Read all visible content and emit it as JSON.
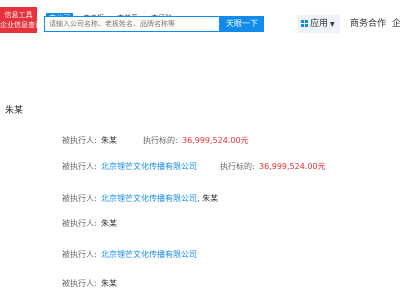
{
  "logo": {
    "line1": "信息工具",
    "line2": "企业信息查询"
  },
  "search": {
    "tabs": [
      "查公司",
      "查老板",
      "查关系",
      "查风险"
    ],
    "placeholder": "请输入公司名称、老板姓名、品牌名称等",
    "button": "天眼一下"
  },
  "nav": {
    "apps": "应用",
    "cooperation": "商务合作",
    "truncated": "企"
  },
  "person": "朱某",
  "labels": {
    "executed_person": "被执行人:",
    "target_amount": "执行标的:"
  },
  "rows": [
    {
      "company": "",
      "person": "朱某",
      "amount": "36,999,524.00元"
    },
    {
      "company": "北京锂芒文化传播有限公司",
      "person": "",
      "amount": "36,999,524.00元"
    },
    {
      "company": "北京锂芒文化传播有限公司",
      "separator": ",",
      "person": "朱某",
      "amount": ""
    },
    {
      "company": "",
      "person": "朱某",
      "amount": ""
    },
    {
      "company": "北京锂芒文化传播有限公司",
      "person": "",
      "amount": ""
    },
    {
      "company": "",
      "person": "朱某",
      "amount": ""
    }
  ],
  "colors": {
    "brand_blue": "#128bed",
    "alert_red": "#e8313a"
  }
}
